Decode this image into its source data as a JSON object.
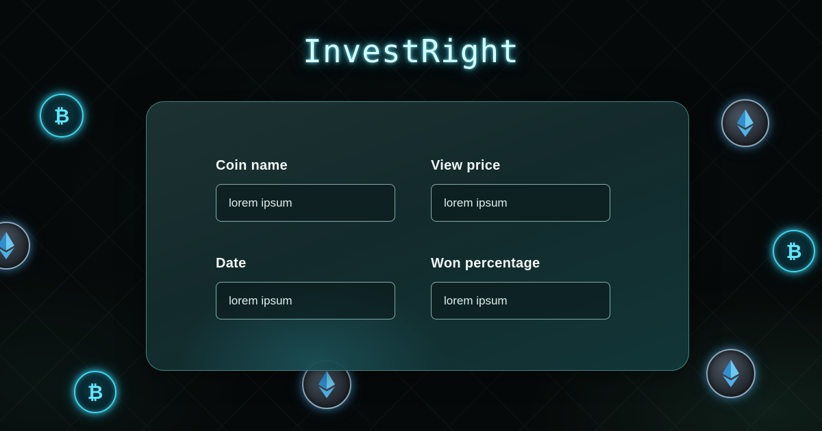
{
  "brand": {
    "name": "InvestRight"
  },
  "form": {
    "fields": [
      {
        "label": "Coin name",
        "placeholder": "lorem ipsum"
      },
      {
        "label": "View price",
        "placeholder": "lorem ipsum"
      },
      {
        "label": "Date",
        "placeholder": "lorem ipsum"
      },
      {
        "label": "Won percentage",
        "placeholder": "lorem ipsum"
      }
    ]
  },
  "decorations": {
    "coins": [
      "bitcoin-icon",
      "ethereum-icon"
    ]
  },
  "colors": {
    "accent_glow": "#3fd6ee",
    "background": "#060909",
    "card_border": "#78e6dc",
    "text": "#f1f6f5"
  }
}
